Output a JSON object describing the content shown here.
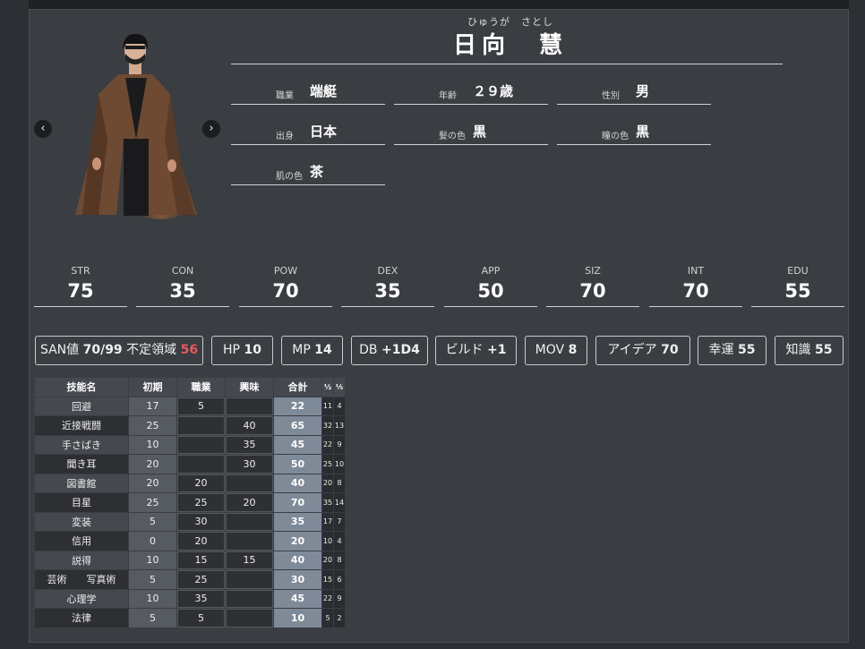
{
  "profile": {
    "ruby": "ひゅうが　さとし",
    "name": "日向　慧",
    "fields": [
      {
        "label": "職業",
        "value": "端艇"
      },
      {
        "label": "年齢",
        "value": "２９歳"
      },
      {
        "label": "性別",
        "value": "男"
      },
      {
        "label": "出身",
        "value": "日本"
      },
      {
        "label": "髪の色",
        "value": "黒"
      },
      {
        "label": "瞳の色",
        "value": "黒"
      },
      {
        "label": "肌の色",
        "value": "茶"
      }
    ]
  },
  "nav": {
    "prev": "‹",
    "next": "›"
  },
  "stats": [
    {
      "label": "STR",
      "value": "75"
    },
    {
      "label": "CON",
      "value": "35"
    },
    {
      "label": "POW",
      "value": "70"
    },
    {
      "label": "DEX",
      "value": "35"
    },
    {
      "label": "APP",
      "value": "50"
    },
    {
      "label": "SIZ",
      "value": "70"
    },
    {
      "label": "INT",
      "value": "70"
    },
    {
      "label": "EDU",
      "value": "55"
    }
  ],
  "derived": {
    "san_label": "SAN値",
    "san_value": "70/99",
    "indef_label": "不定領域",
    "indef_value": "56",
    "hp_label": "HP",
    "hp_value": "10",
    "mp_label": "MP",
    "mp_value": "14",
    "db_label": "DB",
    "db_value": "+1D4",
    "build_label": "ビルド",
    "build_value": "+1",
    "mov_label": "MOV",
    "mov_value": "8",
    "idea_label": "アイデア",
    "idea_value": "70",
    "luck_label": "幸運",
    "luck_value": "55",
    "know_label": "知識",
    "know_value": "55"
  },
  "skills": {
    "headers": [
      "技能名",
      "初期",
      "職業",
      "興味",
      "合計",
      "½",
      "⅕"
    ],
    "rows": [
      {
        "name": "回避",
        "base": "17",
        "job": "5",
        "hobby": "",
        "total": "22",
        "half": "11",
        "fifth": "4"
      },
      {
        "name": "近接戦闘",
        "base": "25",
        "job": "",
        "hobby": "40",
        "total": "65",
        "half": "32",
        "fifth": "13"
      },
      {
        "name": "手さばき",
        "base": "10",
        "job": "",
        "hobby": "35",
        "total": "45",
        "half": "22",
        "fifth": "9"
      },
      {
        "name": "聞き耳",
        "base": "20",
        "job": "",
        "hobby": "30",
        "total": "50",
        "half": "25",
        "fifth": "10"
      },
      {
        "name": "図書館",
        "base": "20",
        "job": "20",
        "hobby": "",
        "total": "40",
        "half": "20",
        "fifth": "8"
      },
      {
        "name": "目星",
        "base": "25",
        "job": "25",
        "hobby": "20",
        "total": "70",
        "half": "35",
        "fifth": "14"
      },
      {
        "name": "変装",
        "base": "5",
        "job": "30",
        "hobby": "",
        "total": "35",
        "half": "17",
        "fifth": "7"
      },
      {
        "name": "信用",
        "base": "0",
        "job": "20",
        "hobby": "",
        "total": "20",
        "half": "10",
        "fifth": "4"
      },
      {
        "name": "説得",
        "base": "10",
        "job": "15",
        "hobby": "15",
        "total": "40",
        "half": "20",
        "fifth": "8"
      },
      {
        "name": "芸術　　写真術",
        "base": "5",
        "job": "25",
        "hobby": "",
        "total": "30",
        "half": "15",
        "fifth": "6"
      },
      {
        "name": "心理学",
        "base": "10",
        "job": "35",
        "hobby": "",
        "total": "45",
        "half": "22",
        "fifth": "9"
      },
      {
        "name": "法律",
        "base": "5",
        "job": "5",
        "hobby": "",
        "total": "10",
        "half": "5",
        "fifth": "2"
      }
    ]
  }
}
